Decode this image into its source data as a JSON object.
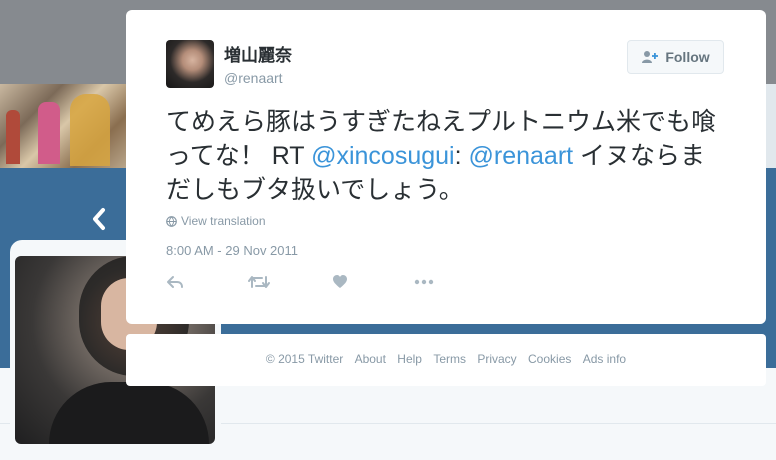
{
  "tweet": {
    "author_name": "増山麗奈",
    "author_handle": "@renaart",
    "follow_label": "Follow",
    "text_parts": {
      "lead": "てめえら豚はうすぎたねえプルトニウム米でも喰ってな！ RT ",
      "mention1": "@xincosugui",
      "colon": ": ",
      "mention2": "@renaart",
      "tail": " イヌならまだしもブタ扱いでしょう。"
    },
    "translate_label": "View translation",
    "timestamp": "8:00 AM - 29 Nov 2011",
    "actions": [
      "reply-icon",
      "retweet-icon",
      "like-icon",
      "more-icon"
    ]
  },
  "footer": {
    "links": [
      "© 2015 Twitter",
      "About",
      "Help",
      "Terms",
      "Privacy",
      "Cookies",
      "Ads info"
    ]
  },
  "colors": {
    "link": "#3b94d9",
    "profile_banner": "#3b6d99",
    "muted": "#8899a6",
    "text": "#292f33"
  }
}
